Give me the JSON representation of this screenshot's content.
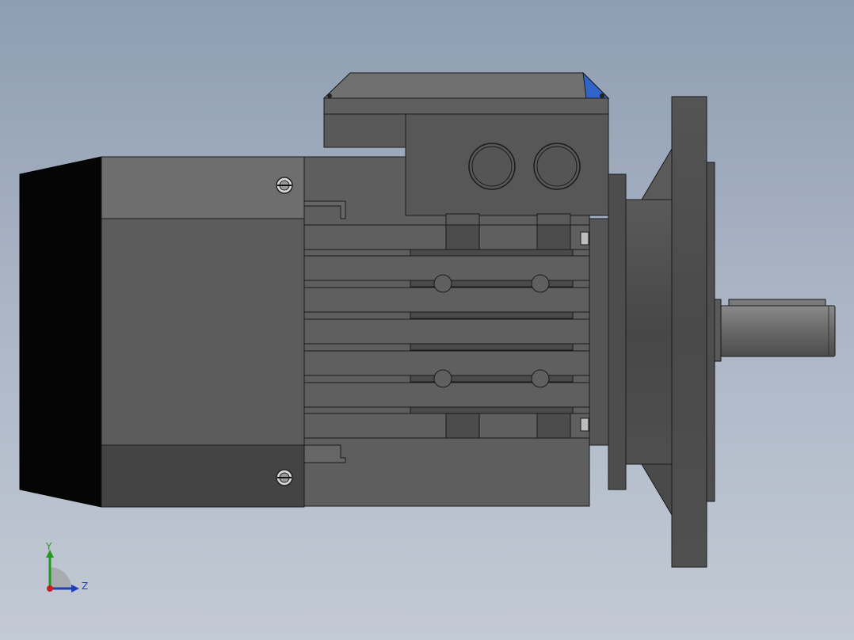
{
  "viewport": {
    "background_top": "#8e9db2",
    "background_bottom": "#c3cad5"
  },
  "model": {
    "colors": {
      "fan_cover": "#050505",
      "body_light": "#6e6e6e",
      "body_mid": "#5b5b5b",
      "body_dark": "#474747",
      "edge": "#1a1a1a",
      "accent_blue": "#2f64c8"
    }
  },
  "triad": {
    "y_label": "Y",
    "z_label": "Z",
    "y_color": "#1f9a1f",
    "z_color": "#1f3fb8",
    "x_color": "#c81f1f"
  }
}
